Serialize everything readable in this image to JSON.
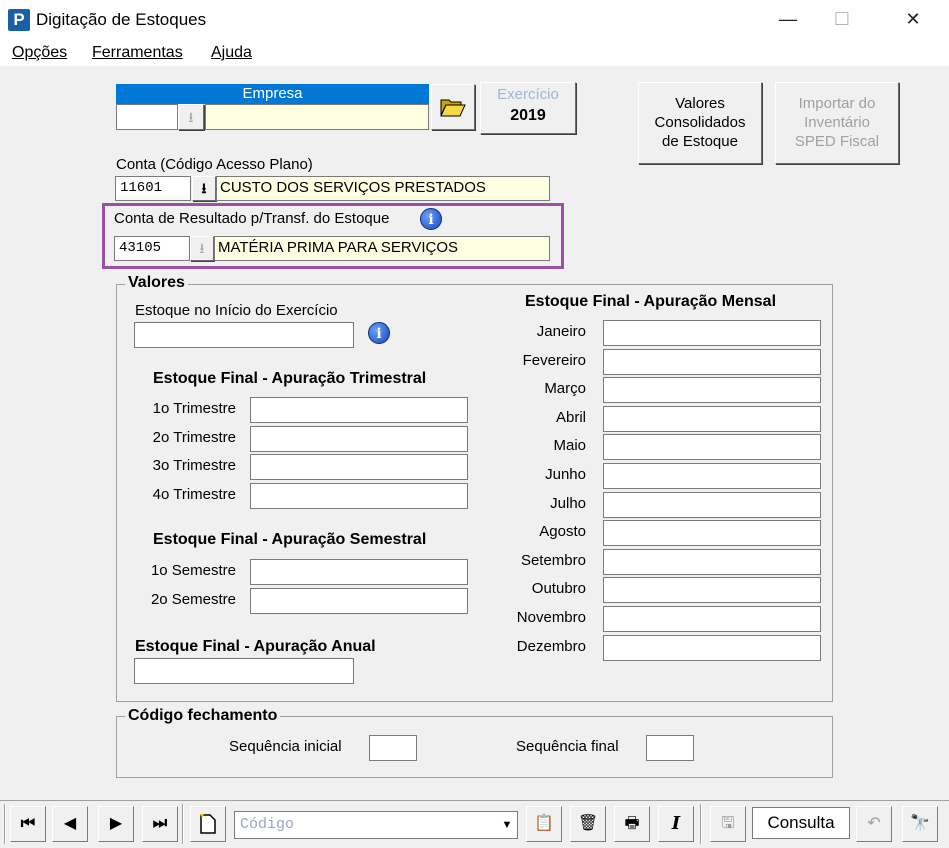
{
  "window": {
    "title": "Digitação de Estoques",
    "minimize": "—",
    "maximize": "☐",
    "close": "✕"
  },
  "menu": {
    "opcoes": "Opções",
    "ferramentas": "Ferramentas",
    "ajuda": "Ajuda"
  },
  "empresa": {
    "header": "Empresa",
    "code": "",
    "name": ""
  },
  "exercicio": {
    "label": "Exercício",
    "value": "2019"
  },
  "buttons": {
    "valores_consolidados": "Valores Consolidados de Estoque",
    "importar_inventario": "Importar do Inventário SPED Fiscal"
  },
  "conta": {
    "label": "Conta (Código Acesso Plano)",
    "code": "11601",
    "name": "CUSTO DOS SERVIÇOS PRESTADOS"
  },
  "conta_resultado": {
    "label": "Conta de Resultado p/Transf. do Estoque",
    "code": "43105",
    "name": "MATÉRIA PRIMA PARA SERVIÇOS"
  },
  "valores": {
    "group_title": "Valores",
    "estoque_inicio_label": "Estoque no Início do Exercício",
    "estoque_inicio_value": "",
    "trimestral_title": "Estoque Final - Apuração Trimestral",
    "trimestres": [
      "1o Trimestre",
      "2o Trimestre",
      "3o Trimestre",
      "4o Trimestre"
    ],
    "semestral_title": "Estoque Final - Apuração Semestral",
    "semestres": [
      "1o Semestre",
      "2o Semestre"
    ],
    "anual_title": "Estoque Final - Apuração Anual",
    "mensal_title": "Estoque Final - Apuração Mensal",
    "meses": [
      "Janeiro",
      "Fevereiro",
      "Março",
      "Abril",
      "Maio",
      "Junho",
      "Julho",
      "Agosto",
      "Setembro",
      "Outubro",
      "Novembro",
      "Dezembro"
    ]
  },
  "fechamento": {
    "group_title": "Código fechamento",
    "seq_inicial_label": "Sequência inicial",
    "seq_final_label": "Sequência final",
    "seq_inicial": "",
    "seq_final": ""
  },
  "toolbar": {
    "search_placeholder": "Código",
    "mode_label": "Consulta"
  },
  "colors": {
    "empresa_header_bg": "#0078d7",
    "highlight_border": "#9b4fa6",
    "yellow_field": "#ffffe1"
  }
}
